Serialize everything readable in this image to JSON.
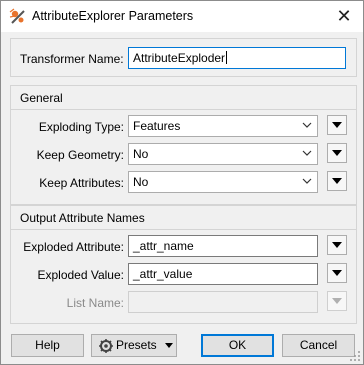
{
  "window": {
    "title": "AttributeExplorer Parameters",
    "close_label": "✕"
  },
  "transformer": {
    "label": "Transformer Name:",
    "value": "AttributeExploder"
  },
  "general": {
    "title": "General",
    "exploding_type": {
      "label": "Exploding Type:",
      "value": "Features"
    },
    "keep_geometry": {
      "label": "Keep Geometry:",
      "value": "No"
    },
    "keep_attributes": {
      "label": "Keep Attributes:",
      "value": "No"
    }
  },
  "output": {
    "title": "Output Attribute Names",
    "exploded_attribute": {
      "label": "Exploded Attribute:",
      "value": "_attr_name"
    },
    "exploded_value": {
      "label": "Exploded Value:",
      "value": "_attr_value"
    },
    "list_name": {
      "label": "List Name:",
      "value": ""
    }
  },
  "buttons": {
    "help": "Help",
    "presets": "Presets",
    "ok": "OK",
    "cancel": "Cancel"
  },
  "icons": {
    "title": "transformer-icon",
    "presets": "gear-icon",
    "dropdown": "triangle-down-icon"
  },
  "colors": {
    "focus": "#0078d7",
    "disabled_text": "#8a8a8a"
  }
}
